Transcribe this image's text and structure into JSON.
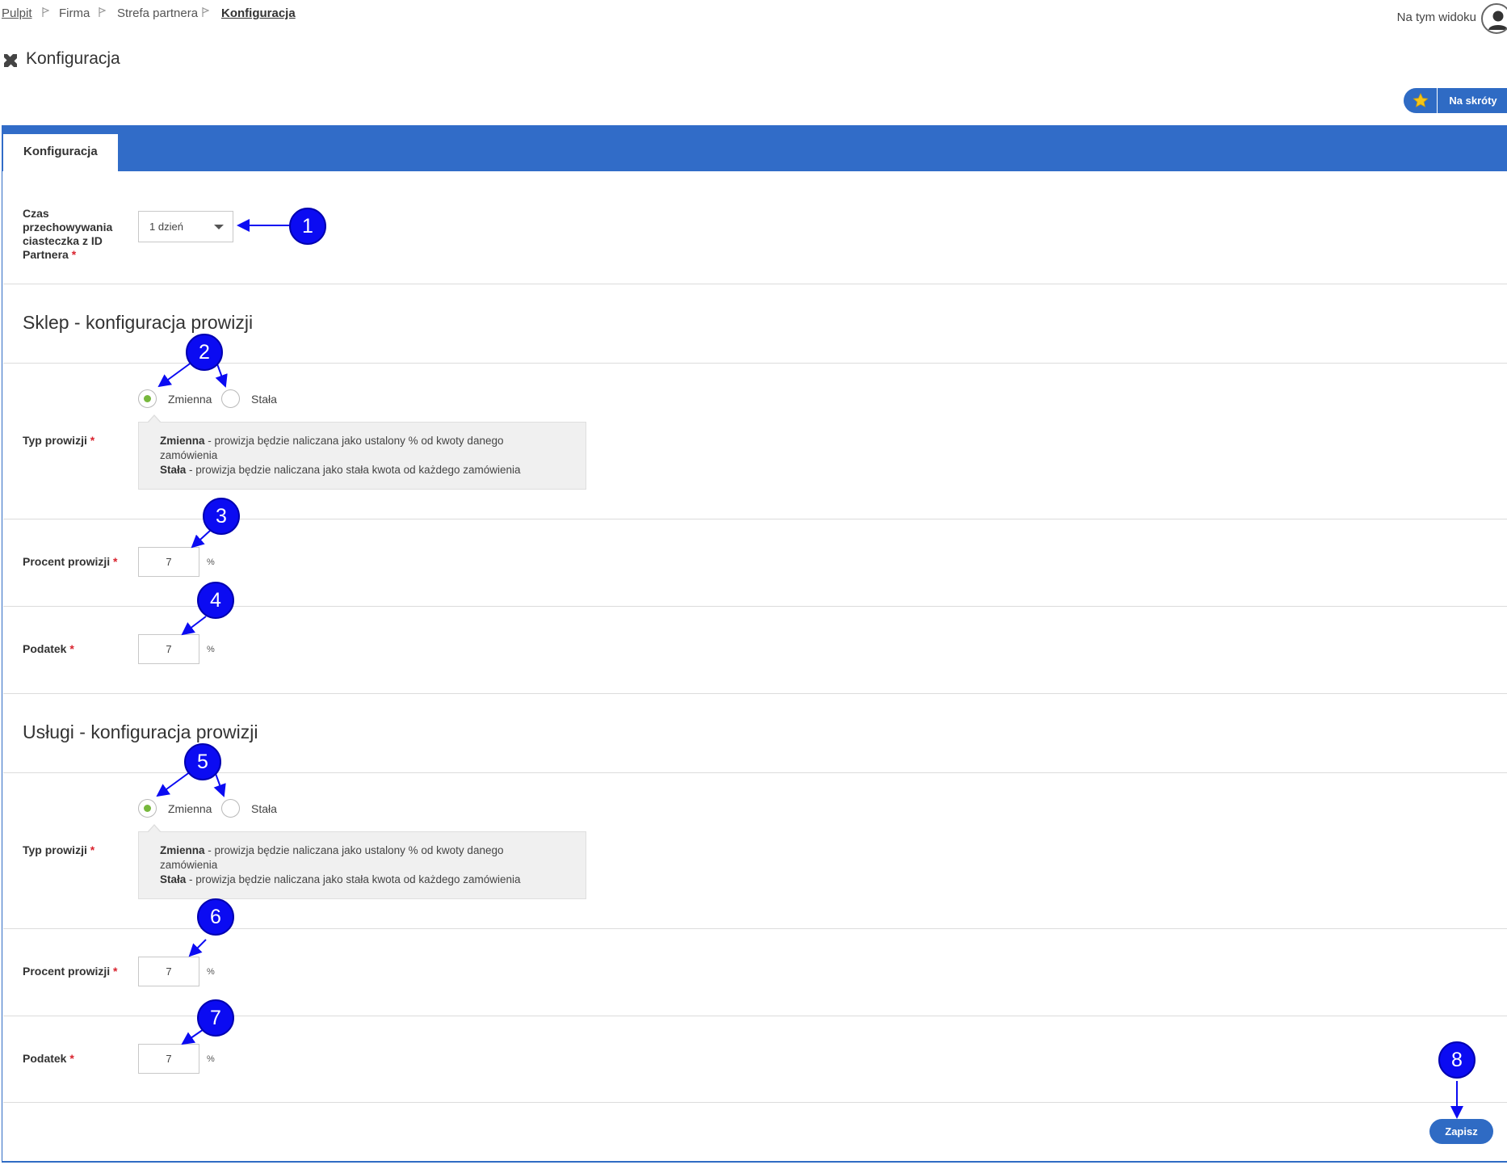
{
  "breadcrumb": {
    "items": [
      "Pulpit",
      "Firma",
      "Strefa partnera",
      "Konfiguracja"
    ]
  },
  "header": {
    "view_label": "Na tym widoku",
    "page_title": "Konfiguracja",
    "shortcut_label": "Na skróty"
  },
  "tabs": [
    {
      "label": "Konfiguracja",
      "active": true
    }
  ],
  "cookie": {
    "label_lines": [
      "Czas",
      "przechowywania",
      "ciasteczka z ID",
      "Partnera"
    ],
    "required_mark": "*",
    "selected": "1 dzień"
  },
  "shop": {
    "section_title": "Sklep - konfiguracja prowizji",
    "type_label": "Typ prowizji",
    "radio_option_1": "Zmienna",
    "radio_option_2": "Stała",
    "selected_option": "Zmienna",
    "info_term_1": "Zmienna",
    "info_text_1": " - prowizja będzie naliczana jako ustalony % od kwoty danego zamówienia",
    "info_term_2": "Stała",
    "info_text_2": " - prowizja będzie naliczana jako stała kwota od każdego zamówienia",
    "percent_label": "Procent prowizji",
    "percent_value": "7",
    "percent_unit": "%",
    "tax_label": "Podatek",
    "tax_value": "7",
    "tax_unit": "%"
  },
  "services": {
    "section_title": "Usługi - konfiguracja prowizji",
    "type_label": "Typ prowizji",
    "radio_option_1": "Zmienna",
    "radio_option_2": "Stała",
    "selected_option": "Zmienna",
    "info_term_1": "Zmienna",
    "info_text_1": " - prowizja będzie naliczana jako ustalony % od kwoty danego zamówienia",
    "info_term_2": "Stała",
    "info_text_2": " - prowizja będzie naliczana jako stała kwota od każdego zamówienia",
    "percent_label": "Procent prowizji",
    "percent_value": "7",
    "percent_unit": "%",
    "tax_label": "Podatek",
    "tax_value": "7",
    "tax_unit": "%"
  },
  "required_mark": "*",
  "save_label": "Zapisz",
  "callouts": [
    "1",
    "2",
    "3",
    "4",
    "5",
    "6",
    "7",
    "8"
  ],
  "colors": {
    "accent": "#316cc8",
    "radio_checked": "#77b83d",
    "callout": "#0b0bf2",
    "required": "#d9232e"
  },
  "icons": {
    "title": "tools-icon",
    "breadcrumb_separator": "flag-icon",
    "avatar": "user-icon",
    "shortcut": "star-icon",
    "select": "caret-down-icon"
  }
}
